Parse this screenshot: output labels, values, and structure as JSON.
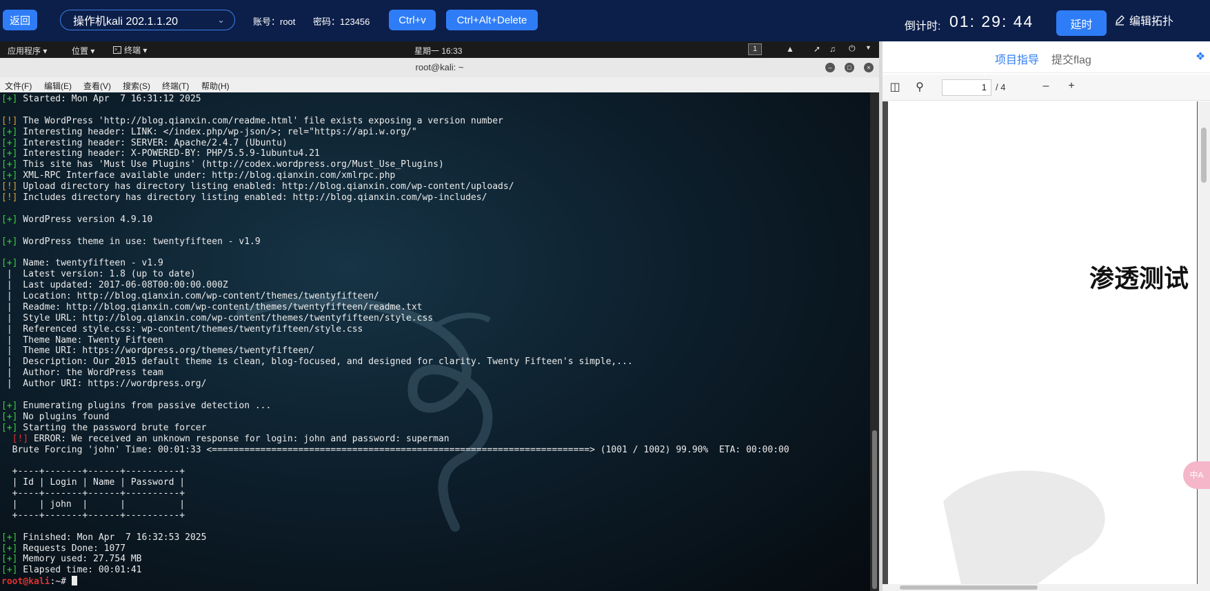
{
  "topbar": {
    "back_label": "返回",
    "vm_select_value": "操作机kali 202.1.1.20",
    "account_label": "账号：root",
    "password_label": "密码：123456",
    "ctrlv_label": "Ctrl+v",
    "cad_label": "Ctrl+Alt+Delete",
    "countdown_label": "倒计时:",
    "countdown_value": "01: 29: 44",
    "extend_label": "延时",
    "edit_topology_label": "编辑拓扑",
    "accent_color": "#2f7df6",
    "bg_color": "#0c1f4a"
  },
  "kali_panel": {
    "apps_label": "应用程序 ▾",
    "places_label": "位置 ▾",
    "terminal_label": "终端 ▾",
    "clock": "星期一 16:33",
    "workspace": "1"
  },
  "terminal_window": {
    "title": "root@kali: ~",
    "menu": [
      "文件(F)",
      "编辑(E)",
      "查看(V)",
      "搜索(S)",
      "终端(T)",
      "帮助(H)"
    ]
  },
  "terminal": {
    "lines": [
      {
        "p": "[+]",
        "c": "pfx",
        "t": " Started: Mon Apr  7 16:31:12 2025"
      },
      {
        "p": "",
        "c": "",
        "t": ""
      },
      {
        "p": "[!]",
        "c": "warn",
        "t": " The WordPress 'http://blog.qianxin.com/readme.html' file exists exposing a version number"
      },
      {
        "p": "[+]",
        "c": "pfx",
        "t": " Interesting header: LINK: </index.php/wp-json/>; rel=\"https://api.w.org/\""
      },
      {
        "p": "[+]",
        "c": "pfx",
        "t": " Interesting header: SERVER: Apache/2.4.7 (Ubuntu)"
      },
      {
        "p": "[+]",
        "c": "pfx",
        "t": " Interesting header: X-POWERED-BY: PHP/5.5.9-1ubuntu4.21"
      },
      {
        "p": "[+]",
        "c": "pfx",
        "t": " This site has 'Must Use Plugins' (http://codex.wordpress.org/Must_Use_Plugins)"
      },
      {
        "p": "[+]",
        "c": "pfx",
        "t": " XML-RPC Interface available under: http://blog.qianxin.com/xmlrpc.php"
      },
      {
        "p": "[!]",
        "c": "warn",
        "t": " Upload directory has directory listing enabled: http://blog.qianxin.com/wp-content/uploads/"
      },
      {
        "p": "[!]",
        "c": "warn",
        "t": " Includes directory has directory listing enabled: http://blog.qianxin.com/wp-includes/"
      },
      {
        "p": "",
        "c": "",
        "t": ""
      },
      {
        "p": "[+]",
        "c": "pfx",
        "t": " WordPress version 4.9.10"
      },
      {
        "p": "",
        "c": "",
        "t": ""
      },
      {
        "p": "[+]",
        "c": "pfx",
        "t": " WordPress theme in use: twentyfifteen - v1.9"
      },
      {
        "p": "",
        "c": "",
        "t": ""
      },
      {
        "p": "[+]",
        "c": "pfx",
        "t": " Name: twentyfifteen - v1.9"
      },
      {
        "p": "",
        "c": "",
        "t": " |  Latest version: 1.8 (up to date)"
      },
      {
        "p": "",
        "c": "",
        "t": " |  Last updated: 2017-06-08T00:00:00.000Z"
      },
      {
        "p": "",
        "c": "",
        "t": " |  Location: http://blog.qianxin.com/wp-content/themes/twentyfifteen/"
      },
      {
        "p": "",
        "c": "",
        "t": " |  Readme: http://blog.qianxin.com/wp-content/themes/twentyfifteen/readme.txt"
      },
      {
        "p": "",
        "c": "",
        "t": " |  Style URL: http://blog.qianxin.com/wp-content/themes/twentyfifteen/style.css"
      },
      {
        "p": "",
        "c": "",
        "t": " |  Referenced style.css: wp-content/themes/twentyfifteen/style.css"
      },
      {
        "p": "",
        "c": "",
        "t": " |  Theme Name: Twenty Fifteen"
      },
      {
        "p": "",
        "c": "",
        "t": " |  Theme URI: https://wordpress.org/themes/twentyfifteen/"
      },
      {
        "p": "",
        "c": "",
        "t": " |  Description: Our 2015 default theme is clean, blog-focused, and designed for clarity. Twenty Fifteen's simple,..."
      },
      {
        "p": "",
        "c": "",
        "t": " |  Author: the WordPress team"
      },
      {
        "p": "",
        "c": "",
        "t": " |  Author URI: https://wordpress.org/"
      },
      {
        "p": "",
        "c": "",
        "t": ""
      },
      {
        "p": "[+]",
        "c": "pfx",
        "t": " Enumerating plugins from passive detection ..."
      },
      {
        "p": "[+]",
        "c": "pfx",
        "t": " No plugins found"
      },
      {
        "p": "[+]",
        "c": "pfx",
        "t": " Starting the password brute forcer"
      },
      {
        "p": "  [!]",
        "c": "err",
        "t": " ERROR: We received an unknown response for login: john and password: superman"
      },
      {
        "p": "",
        "c": "",
        "t": "  Brute Forcing 'john' Time: 00:01:33 <======================================================================> (1001 / 1002) 99.90%  ETA: 00:00:00"
      },
      {
        "p": "",
        "c": "",
        "t": ""
      },
      {
        "p": "",
        "c": "",
        "t": "  +----+-------+------+----------+"
      },
      {
        "p": "",
        "c": "",
        "t": "  | Id | Login | Name | Password |"
      },
      {
        "p": "",
        "c": "",
        "t": "  +----+-------+------+----------+"
      },
      {
        "p": "",
        "c": "",
        "t": "  |    | john  |      |          |"
      },
      {
        "p": "",
        "c": "",
        "t": "  +----+-------+------+----------+"
      },
      {
        "p": "",
        "c": "",
        "t": ""
      },
      {
        "p": "[+]",
        "c": "pfx",
        "t": " Finished: Mon Apr  7 16:32:53 2025"
      },
      {
        "p": "[+]",
        "c": "pfx",
        "t": " Requests Done: 1077"
      },
      {
        "p": "[+]",
        "c": "pfx",
        "t": " Memory used: 27.754 MB"
      },
      {
        "p": "[+]",
        "c": "pfx",
        "t": " Elapsed time: 00:01:41"
      }
    ],
    "prompt_user": "root@kali",
    "prompt_rest": ":~# "
  },
  "right_pane": {
    "tab_guide": "项目指导",
    "tab_flag": "提交flag",
    "page_current": "1",
    "page_total": "/ 4",
    "pdf_title": "渗透测试"
  },
  "translate_fab": "中A"
}
